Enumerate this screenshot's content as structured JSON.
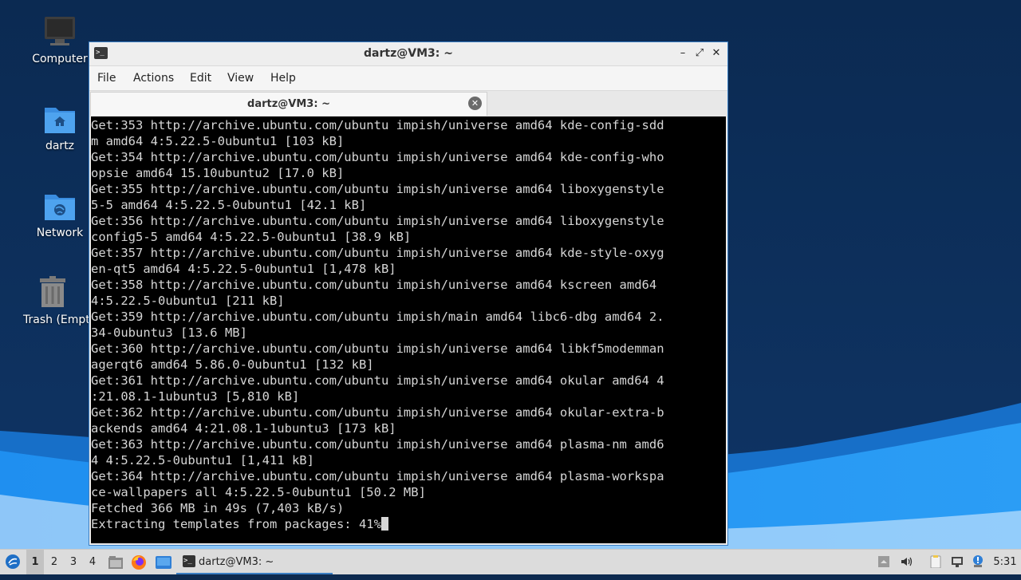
{
  "desktop": {
    "icons": [
      {
        "label": "Computer",
        "icon": "computer-icon"
      },
      {
        "label": "dartz",
        "icon": "home-folder-icon"
      },
      {
        "label": "Network",
        "icon": "network-folder-icon"
      },
      {
        "label": "Trash (Empty)",
        "icon": "trash-icon"
      }
    ]
  },
  "window": {
    "title": "dartz@VM3: ~",
    "controls": {
      "minimize": "–",
      "maximize": "⤢",
      "close": "✕"
    },
    "menu": [
      "File",
      "Actions",
      "Edit",
      "View",
      "Help"
    ],
    "tab": {
      "label": "dartz@VM3: ~",
      "close": "✕"
    },
    "terminal": {
      "lines": [
        "Get:353 http://archive.ubuntu.com/ubuntu impish/universe amd64 kde-config-sdd",
        "m amd64 4:5.22.5-0ubuntu1 [103 kB]",
        "Get:354 http://archive.ubuntu.com/ubuntu impish/universe amd64 kde-config-who",
        "opsie amd64 15.10ubuntu2 [17.0 kB]",
        "Get:355 http://archive.ubuntu.com/ubuntu impish/universe amd64 liboxygenstyle",
        "5-5 amd64 4:5.22.5-0ubuntu1 [42.1 kB]",
        "Get:356 http://archive.ubuntu.com/ubuntu impish/universe amd64 liboxygenstyle",
        "config5-5 amd64 4:5.22.5-0ubuntu1 [38.9 kB]",
        "Get:357 http://archive.ubuntu.com/ubuntu impish/universe amd64 kde-style-oxyg",
        "en-qt5 amd64 4:5.22.5-0ubuntu1 [1,478 kB]",
        "Get:358 http://archive.ubuntu.com/ubuntu impish/universe amd64 kscreen amd64",
        "4:5.22.5-0ubuntu1 [211 kB]",
        "Get:359 http://archive.ubuntu.com/ubuntu impish/main amd64 libc6-dbg amd64 2.",
        "34-0ubuntu3 [13.6 MB]",
        "Get:360 http://archive.ubuntu.com/ubuntu impish/universe amd64 libkf5modemman",
        "agerqt6 amd64 5.86.0-0ubuntu1 [132 kB]",
        "Get:361 http://archive.ubuntu.com/ubuntu impish/universe amd64 okular amd64 4",
        ":21.08.1-1ubuntu3 [5,810 kB]",
        "Get:362 http://archive.ubuntu.com/ubuntu impish/universe amd64 okular-extra-b",
        "ackends amd64 4:21.08.1-1ubuntu3 [173 kB]",
        "Get:363 http://archive.ubuntu.com/ubuntu impish/universe amd64 plasma-nm amd6",
        "4 4:5.22.5-0ubuntu1 [1,411 kB]",
        "Get:364 http://archive.ubuntu.com/ubuntu impish/universe amd64 plasma-workspa",
        "ce-wallpapers all 4:5.22.5-0ubuntu1 [50.2 MB]",
        "Fetched 366 MB in 49s (7,403 kB/s)"
      ],
      "prompt_line": "Extracting templates from packages: 41%"
    }
  },
  "taskbar": {
    "workspaces": [
      "1",
      "2",
      "3",
      "4"
    ],
    "active_workspace": "1",
    "task_label": "dartz@VM3: ~",
    "clock": "5:31"
  },
  "colors": {
    "accent": "#3b7fc4",
    "terminal_bg": "#000000",
    "terminal_fg": "#d6d6d6",
    "taskbar_bg": "#dcdcdc"
  }
}
